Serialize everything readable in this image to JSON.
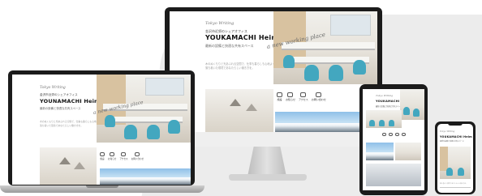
{
  "site": {
    "logo": "Tokyo Writing",
    "tagline": "金沢市近郊のシェアオフィス",
    "title": "YOUKAMACHI Heim",
    "title_alt": "YOUNAMACHI Heim",
    "subtitle": "最新の設備と快適な共有スペース",
    "script_text": "a new working place",
    "body_text": "木のぬくもりと光あふれる空間で、仕事も暮らしも心地よく。",
    "body_text_2": "落ち着いた環境であなたらしい働き方を。",
    "icons": [
      {
        "name": "home-icon",
        "label": "施設"
      },
      {
        "name": "document-icon",
        "label": "お知らせ"
      },
      {
        "name": "access-icon",
        "label": "アクセス"
      },
      {
        "name": "contact-icon",
        "label": "お問い合わせ"
      }
    ]
  },
  "colors": {
    "accent": "#43a7bf",
    "bezel": "#1b1b1b",
    "stand": "#c9c9c9"
  }
}
